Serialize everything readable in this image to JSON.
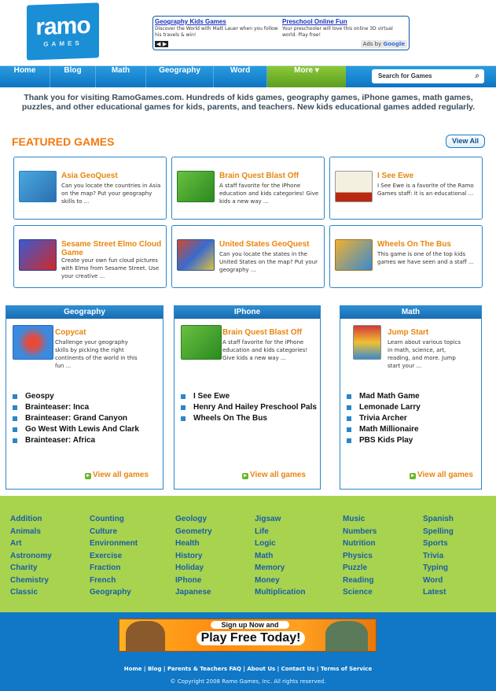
{
  "brand": {
    "name": "ramo",
    "tag": "GAMES"
  },
  "ads": [
    {
      "title": "Geography Kids Games",
      "text": "Discover the World with Matt Lauer when you follow his travels & win!"
    },
    {
      "title": "Preschool Online Fun",
      "text": "Your preschooler will love this online 3D virtual world. Play free!"
    }
  ],
  "ads_by": {
    "prefix": "Ads by",
    "brand": "Google"
  },
  "ads_nav": "◀ ▶",
  "nav": [
    {
      "label": "Home"
    },
    {
      "label": "Blog"
    },
    {
      "label": "Math"
    },
    {
      "label": "Geography"
    },
    {
      "label": "Word"
    },
    {
      "label": "More"
    }
  ],
  "search": {
    "placeholder": "Search for Games"
  },
  "intro": "Thank you for visiting RamoGames.com. Hundreds of kids games, geography games, iPhone games, math games, puzzles, and other educational games for kids, parents, and teachers. New kids educational games added regularly.",
  "featured": {
    "title": "FEATURED GAMES",
    "view_all": "View All",
    "games": [
      {
        "title": "Asia GeoQuest",
        "desc": "Can you locate the countries in Asia on the map? Put your geography skills to ..."
      },
      {
        "title": "Brain Quest Blast Off",
        "desc": "A staff favorite for the iPhone education and kids categories! Give kids a new way ..."
      },
      {
        "title": "I See Ewe",
        "desc": "I See Ewe is a favorite of the Ramo Games staff: it is an educational ..."
      },
      {
        "title": "Sesame Street Elmo Cloud Game",
        "desc": "Create your own fun cloud pictures with Elmo from Sesame Street. Use your creative ..."
      },
      {
        "title": "United States GeoQuest",
        "desc": "Can you locate the states in the United States on the map? Put your geography ..."
      },
      {
        "title": "Wheels On The Bus",
        "desc": "This game is one of the top kids games we have seen and a staff ..."
      }
    ]
  },
  "sections": [
    {
      "name": "Geography",
      "game": "Copycat",
      "desc": "Challenge your geography skills by picking the right continents of the world in this fun ...",
      "list": [
        "Geospy",
        "Brainteaser: Inca",
        "Brainteaser: Grand Canyon",
        "Go West With Lewis And Clark",
        "Brainteaser: Africa"
      ],
      "view": "View all games"
    },
    {
      "name": "IPhone",
      "game": "Brain Quest Blast Off",
      "desc": "A staff favorite for the iPhone education and kids categories! Give kids a new way ...",
      "list": [
        "I See Ewe",
        "Henry And Hailey Preschool Pals",
        "Wheels On The Bus"
      ],
      "view": "View all games"
    },
    {
      "name": "Math",
      "game": "Jump Start",
      "desc": "Learn about various topics in math, science, art, reading, and more. Jump start your ...",
      "list": [
        "Mad Math Game",
        "Lemonade Larry",
        "Trivia Archer",
        "Math Millionaire",
        "PBS Kids Play"
      ],
      "view": "View all games"
    }
  ],
  "categories": [
    [
      "Addition",
      "Animals",
      "Art",
      "Astronomy",
      "Charity",
      "Chemistry",
      "Classic"
    ],
    [
      "Counting",
      "Culture",
      "Environment",
      "Exercise",
      "Fraction",
      "French",
      "Geography"
    ],
    [
      "Geology",
      "Geometry",
      "Health",
      "History",
      "Holiday",
      "IPhone",
      "Japanese"
    ],
    [
      "Jigsaw",
      "Life",
      "Logic",
      "Math",
      "Memory",
      "Money",
      "Multiplication"
    ],
    [
      "Music",
      "Numbers",
      "Nutrition",
      "Physics",
      "Puzzle",
      "Reading",
      "Science"
    ],
    [
      "Spanish",
      "Spelling",
      "Sports",
      "Trivia",
      "Typing",
      "Word",
      "Latest"
    ]
  ],
  "banner": {
    "line1": "Sign up Now and",
    "line2": "Play Free Today!"
  },
  "footer": {
    "links": [
      "Home",
      "Blog",
      "Parents & Teachers FAQ",
      "About Us",
      "Contact Us",
      "Terms of Service"
    ],
    "copyright": "© Copyright 2008 Ramo Games, Inc. All rights reserved."
  },
  "colors": {
    "accent": "#e8860e",
    "nav_blue": "#1a8fd6",
    "more_green": "#6bb52a",
    "category_bg": "#a8d34e",
    "footer_blue": "#1078c6"
  }
}
